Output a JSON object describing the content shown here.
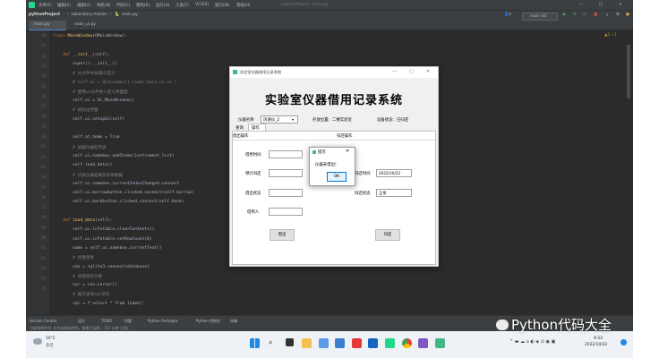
{
  "ide": {
    "menu": [
      "文件(F)",
      "编辑(E)",
      "视图(V)",
      "导航(N)",
      "代码(C)",
      "重构(R)",
      "运行(U)",
      "工具(T)",
      "VCS(S)",
      "窗口(W)",
      "帮助(H)"
    ],
    "window_title": "pythonProject - main.py",
    "project": "pythonProject",
    "path": "laboratory-master",
    "file": "main.py",
    "run_config": "main (4)",
    "tabs": [
      "main.py",
      "main_ui.py"
    ],
    "warnings": "▲2 ✓1",
    "line_numbers": [
      "10",
      "11",
      "12",
      "13",
      "14",
      "15",
      "16",
      "17",
      "18",
      "19",
      "20",
      "21",
      "22",
      "23",
      "24",
      "25",
      "26",
      "27",
      "28",
      "29",
      "30",
      "31",
      "32",
      "33",
      "34",
      "35"
    ],
    "code": [
      {
        "kw": "class ",
        "fn": "MainWindow",
        "rest": "(QMainWindow):"
      },
      {
        "rest": ""
      },
      {
        "kw": "    def ",
        "fn": "__init__",
        "rest": "(self):"
      },
      {
        "rest": "        super().__init__()"
      },
      {
        "cm": "        # 从文件中加载UI定义"
      },
      {
        "cm": "        # self.ui = QUiLoader().load('main_ui.ui')"
      },
      {
        "cm": "        # 使用ui文件导入定义界面类"
      },
      {
        "rest": "        self.ui = Ui_MainWindow()"
      },
      {
        "cm": "        # 初始化界面"
      },
      {
        "rest": "        self.ui.setupUi(self)"
      },
      {
        "rest": ""
      },
      {
        "rest": "        self.at_home = True"
      },
      {
        "cm": "        # 加载仪器名列表"
      },
      {
        "rest": "        self.ui.namebox.addItems(instrument_list)"
      },
      {
        "rest": "        self.load_data()"
      },
      {
        "cm": "        # 切换仪器后刷新表单数据"
      },
      {
        "rest": "        self.ui.namebox.currentIndexChanged.connect"
      },
      {
        "rest": "        self.ui.borrowbutton.clicked.connect(self.borrow)"
      },
      {
        "rest": "        self.ui.backbutton.clicked.connect(self.back)"
      },
      {
        "rest": ""
      },
      {
        "kw": "    def ",
        "fn": "load_data",
        "rest": "(self):"
      },
      {
        "rest": "        self.ui.infotable.clearContents()"
      },
      {
        "rest": "        self.ui.infotable.setRowCount(0)"
      },
      {
        "rest": "        name = self.ui.namebox.currentText()"
      },
      {
        "cm": "        # 创建连接"
      },
      {
        "rest": "        con = sqlite3.connect(database)"
      },
      {
        "cm": "        # 创建游标对象"
      },
      {
        "rest": "        cur = con.cursor()"
      },
      {
        "cm": "        # 编写查询sql语句"
      },
      {
        "rest": "        sql = f'select * from {name}'"
      }
    ],
    "status_tools": [
      "Version Control",
      "运行",
      "TODO",
      "问题",
      "Python Packages",
      "Python 控制台",
      "终端"
    ],
    "status_message": "已安装软件包: 正在安装软件包。查看已安装... (12 分钟 之前)",
    "weather": {
      "temp": "10°C",
      "desc": "多云"
    },
    "clock": {
      "time": "9:33",
      "date": "2022/10/22"
    }
  },
  "dialog": {
    "window_title": "实验室仪器借用记录系统",
    "heading": "实验室仪器借用记录系统",
    "instrument_label": "仪器名称",
    "instrument_value": "风速仪_2",
    "location_label": "存放位置：二楼实验室",
    "status_label": "设备状态：已归还",
    "tabs": [
      "查询",
      "操作"
    ],
    "borrow_section": "借出操作",
    "return_section": "归还操作",
    "fields_left": [
      {
        "label": "借用时间",
        "value": ""
      },
      {
        "label": "预计归还",
        "value": ""
      },
      {
        "label": "借出状态",
        "value": ""
      },
      {
        "label": "借用人",
        "value": ""
      }
    ],
    "fields_right": [
      {
        "label": "归还时间",
        "value": "2022/10/22"
      },
      {
        "label": "归还状态",
        "value": "正常"
      }
    ],
    "borrow_button": "借出",
    "return_button": "归还"
  },
  "message_box": {
    "title": "提示",
    "text": "仪器未借出!",
    "ok": "OK"
  },
  "watermark": "Python代码大全"
}
